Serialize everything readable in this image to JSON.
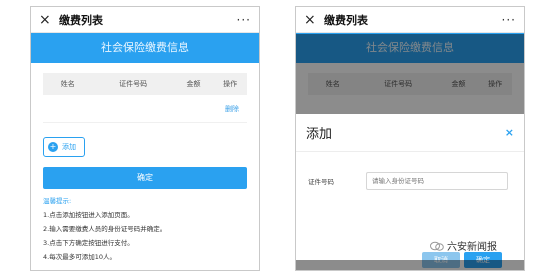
{
  "left": {
    "topbar": {
      "close_icon": "×",
      "title": "缴费列表",
      "more_icon": "···"
    },
    "banner": "社会保险缴费信息",
    "table": {
      "headers": [
        "姓名",
        "证件号码",
        "金额",
        "操作"
      ],
      "row_action": "删除"
    },
    "add_button": {
      "icon": "+",
      "label": "添加"
    },
    "confirm_button": "确定",
    "tips": {
      "title": "温馨提示:",
      "items": [
        "1.点击添加按钮进入添加页面。",
        "2.输入需要缴费人员的身份证号码并确定。",
        "3.点击下方确定按钮进行支付。",
        "4.每次最多可添加10人。"
      ]
    }
  },
  "right": {
    "topbar": {
      "close_icon": "×",
      "title": "缴费列表",
      "more_icon": "···"
    },
    "banner": "社会保险缴费信息",
    "table": {
      "headers": [
        "姓名",
        "证件号码",
        "金额",
        "操作"
      ]
    },
    "modal": {
      "title": "添加",
      "close_icon": "×",
      "field_label": "证件号码",
      "field_placeholder": "请输入身份证号码",
      "cancel": "取消",
      "ok": "确定"
    }
  },
  "watermark": "六安新闻报",
  "colors": {
    "accent": "#2aa1f0"
  }
}
